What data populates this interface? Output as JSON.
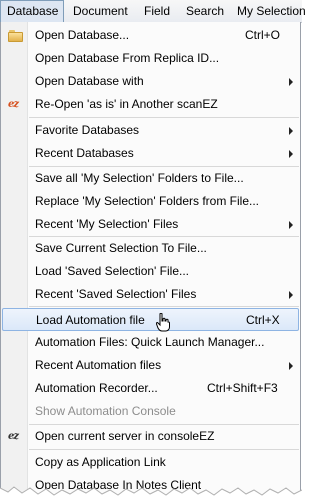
{
  "menubar": {
    "items": [
      "Database",
      "Document",
      "Field",
      "Search",
      "My Selection"
    ]
  },
  "menu": {
    "items": [
      {
        "label": "Open Database...",
        "shortcut": "Ctrl+O",
        "icon": "folder-icon"
      },
      {
        "label": "Open Database From Replica ID..."
      },
      {
        "label": "Open Database with",
        "submenu": true
      },
      {
        "label": "Re-Open 'as is' in Another scanEZ",
        "icon": "scanez-icon"
      },
      {
        "label": "Favorite Databases",
        "submenu": true
      },
      {
        "label": "Recent Databases",
        "submenu": true
      },
      {
        "label": "Save all 'My Selection' Folders to File..."
      },
      {
        "label": "Replace 'My Selection' Folders  from File..."
      },
      {
        "label": "Recent 'My Selection' Files",
        "submenu": true
      },
      {
        "label": "Save Current Selection To File..."
      },
      {
        "label": "Load 'Saved Selection' File..."
      },
      {
        "label": "Recent 'Saved Selection' Files",
        "submenu": true
      },
      {
        "label": "Load Automation file",
        "shortcut": "Ctrl+X",
        "highlighted": true
      },
      {
        "label": "Automation Files: Quick Launch Manager..."
      },
      {
        "label": "Recent Automation files",
        "submenu": true
      },
      {
        "label": "Automation Recorder...",
        "shortcut": "Ctrl+Shift+F3"
      },
      {
        "label": "Show Automation Console",
        "disabled": true
      },
      {
        "label": "Open current server in consoleEZ",
        "icon": "consoleez-icon"
      },
      {
        "label": "Copy as Application Link"
      },
      {
        "label": "Open Database In Notes Client"
      }
    ]
  },
  "icons": {
    "folder": "folder-icon",
    "scanez": "ez-icon",
    "consoleez": "ez-icon",
    "cursor": "pointer-cursor"
  },
  "colors": {
    "highlight_border": "#8eb4e3",
    "highlight_fill": "#dbe8f9",
    "active_menu_fill": "#dde6f2",
    "disabled_text": "#8d8d8d"
  }
}
